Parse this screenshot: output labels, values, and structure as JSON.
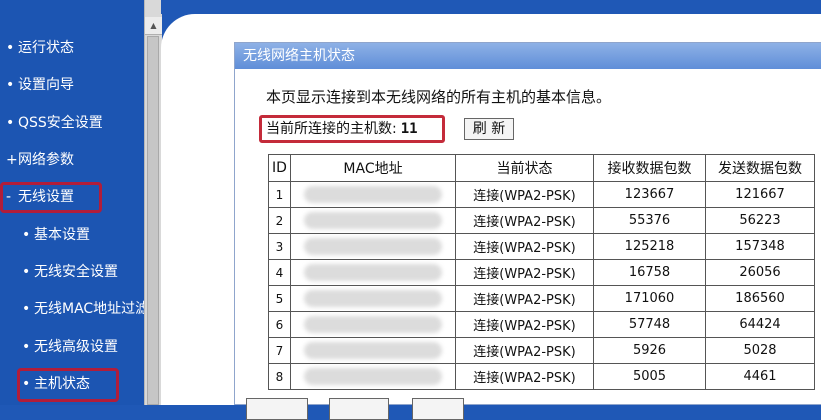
{
  "sidebar": {
    "items": [
      {
        "label": "运行状态",
        "bullet": "•"
      },
      {
        "label": "设置向导",
        "bullet": "•"
      },
      {
        "label": "QSS安全设置",
        "bullet": "•"
      },
      {
        "label": "网络参数",
        "bullet": "+"
      },
      {
        "label": "无线设置",
        "bullet": "-"
      },
      {
        "label": "基本设置",
        "bullet": "•"
      },
      {
        "label": "无线安全设置",
        "bullet": "•"
      },
      {
        "label": "无线MAC地址过滤",
        "bullet": "•"
      },
      {
        "label": "无线高级设置",
        "bullet": "•"
      },
      {
        "label": "主机状态",
        "bullet": "•"
      }
    ]
  },
  "panel": {
    "title": "无线网络主机状态",
    "description": "本页显示连接到本无线网络的所有主机的基本信息。",
    "host_count_label": "当前所连接的主机数:",
    "host_count": "11",
    "refresh_label": "刷 新"
  },
  "table": {
    "headers": [
      "ID",
      "MAC地址",
      "当前状态",
      "接收数据包数",
      "发送数据包数"
    ],
    "rows": [
      {
        "id": "1",
        "status": "连接(WPA2-PSK)",
        "rx": "123667",
        "tx": "121667"
      },
      {
        "id": "2",
        "status": "连接(WPA2-PSK)",
        "rx": "55376",
        "tx": "56223"
      },
      {
        "id": "3",
        "status": "连接(WPA2-PSK)",
        "rx": "125218",
        "tx": "157348"
      },
      {
        "id": "4",
        "status": "连接(WPA2-PSK)",
        "rx": "16758",
        "tx": "26056"
      },
      {
        "id": "5",
        "status": "连接(WPA2-PSK)",
        "rx": "171060",
        "tx": "186560"
      },
      {
        "id": "6",
        "status": "连接(WPA2-PSK)",
        "rx": "57748",
        "tx": "64424"
      },
      {
        "id": "7",
        "status": "连接(WPA2-PSK)",
        "rx": "5926",
        "tx": "5028"
      },
      {
        "id": "8",
        "status": "连接(WPA2-PSK)",
        "rx": "5005",
        "tx": "4461"
      }
    ]
  },
  "colors": {
    "sidebar_bg": "#1c55b2",
    "highlight_red": "#b11d3a",
    "panel_title_bg": "#6f9be0"
  }
}
